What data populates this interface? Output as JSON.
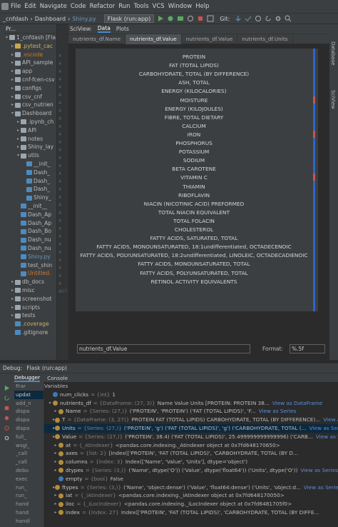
{
  "menu": {
    "items": [
      "File",
      "Edit",
      "Navigate",
      "Code",
      "Refactor",
      "Run",
      "Tools",
      "VCS",
      "Window",
      "Help"
    ]
  },
  "navbar": {
    "crumbs": [
      "_cnfdash",
      "Dashboard",
      "Shiny.py"
    ],
    "run_config": "Flask (run:app)",
    "git_label": "Git:"
  },
  "project": {
    "header": "Pr...",
    "items": [
      {
        "label": "1_cnfdash [Fla",
        "indent": 0,
        "arrow": "▾",
        "type": "folder"
      },
      {
        "label": ".pytest_cac",
        "indent": 1,
        "arrow": "▸",
        "type": "folder-yellow",
        "color": "yellow"
      },
      {
        "label": ".vscode",
        "indent": 1,
        "arrow": "▸",
        "type": "folder",
        "color": "orange"
      },
      {
        "label": "API_sample",
        "indent": 1,
        "arrow": "▸",
        "type": "folder"
      },
      {
        "label": "app",
        "indent": 1,
        "arrow": "▸",
        "type": "folder"
      },
      {
        "label": "cnf-fcen-csv",
        "indent": 1,
        "arrow": "▸",
        "type": "folder"
      },
      {
        "label": "configs",
        "indent": 1,
        "arrow": "▸",
        "type": "folder"
      },
      {
        "label": "csv_cnf",
        "indent": 1,
        "arrow": "▸",
        "type": "folder"
      },
      {
        "label": "csv_nutrien",
        "indent": 1,
        "arrow": "▸",
        "type": "folder"
      },
      {
        "label": "Dashboard",
        "indent": 1,
        "arrow": "▾",
        "type": "folder"
      },
      {
        "label": ".ipynb_ch",
        "indent": 2,
        "arrow": "▸",
        "type": "folder"
      },
      {
        "label": "API",
        "indent": 2,
        "arrow": "▸",
        "type": "folder"
      },
      {
        "label": "notes",
        "indent": 2,
        "arrow": "▸",
        "type": "folder"
      },
      {
        "label": "Shiny_lay",
        "indent": 2,
        "arrow": "▸",
        "type": "folder"
      },
      {
        "label": "utils",
        "indent": 2,
        "arrow": "▾",
        "type": "folder"
      },
      {
        "label": "__init_",
        "indent": 3,
        "arrow": "",
        "type": "py"
      },
      {
        "label": "Dash_",
        "indent": 3,
        "arrow": "",
        "type": "py"
      },
      {
        "label": "Dash_",
        "indent": 3,
        "arrow": "",
        "type": "py"
      },
      {
        "label": "Dash_",
        "indent": 3,
        "arrow": "",
        "type": "py"
      },
      {
        "label": "Shiny_",
        "indent": 3,
        "arrow": "",
        "type": "py"
      },
      {
        "label": "__init__",
        "indent": 2,
        "arrow": "",
        "type": "py"
      },
      {
        "label": "Dash_Ap",
        "indent": 2,
        "arrow": "",
        "type": "py"
      },
      {
        "label": "Dash_Ap",
        "indent": 2,
        "arrow": "",
        "type": "py"
      },
      {
        "label": "Dash_Bo",
        "indent": 2,
        "arrow": "",
        "type": "py"
      },
      {
        "label": "Dash_nu",
        "indent": 2,
        "arrow": "",
        "type": "py"
      },
      {
        "label": "Dash_nu",
        "indent": 2,
        "arrow": "",
        "type": "py"
      },
      {
        "label": "Shiny.py",
        "indent": 2,
        "arrow": "",
        "type": "py",
        "color": "blue"
      },
      {
        "label": "test_shin",
        "indent": 2,
        "arrow": "",
        "type": "py"
      },
      {
        "label": "Untitled.",
        "indent": 2,
        "arrow": "",
        "type": "py",
        "color": "orange"
      },
      {
        "label": "db_docs",
        "indent": 1,
        "arrow": "▸",
        "type": "folder"
      },
      {
        "label": "misc",
        "indent": 1,
        "arrow": "▸",
        "type": "folder"
      },
      {
        "label": "screenshot",
        "indent": 1,
        "arrow": "▸",
        "type": "folder"
      },
      {
        "label": "scripts",
        "indent": 1,
        "arrow": "▸",
        "type": "folder"
      },
      {
        "label": "tests",
        "indent": 1,
        "arrow": "▸",
        "type": "folder"
      },
      {
        "label": ".coverage",
        "indent": 1,
        "arrow": "",
        "type": "file",
        "color": "yellow"
      },
      {
        "label": ".gitignore",
        "indent": 1,
        "arrow": "",
        "type": "file"
      }
    ]
  },
  "gutter": {
    "numbers": [
      "4",
      "4",
      "4",
      "4",
      "4",
      "4",
      "4",
      "4",
      "4",
      "4",
      "4",
      "4",
      "4",
      "4",
      "4",
      "4",
      "4",
      "4",
      "4",
      "4",
      "4",
      "4",
      "4",
      "4",
      "4",
      "4",
      "4",
      "4",
      "4",
      "4",
      "457"
    ]
  },
  "sciview": {
    "header_tabs": [
      "SciView:",
      "Data",
      "Plots"
    ],
    "file_tabs": [
      "nutrients_df.Name",
      "nutrients_df.Value",
      "nutrients_df.Value",
      "nutrients_df.Units"
    ],
    "rows": [
      "PROTEIN",
      "FAT (TOTAL LIPIDS)",
      "CARBOHYDRATE, TOTAL (BY DIFFERENCE)",
      "ASH, TOTAL",
      "ENERGY (KILOCALORIES)",
      "MOISTURE",
      "ENERGY (KILOJOULES)",
      "FIBRE, TOTAL DIETARY",
      "CALCIUM",
      "IRON",
      "PHOSPHORUS",
      "POTASSIUM",
      "SODIUM",
      "BETA CAROTENE",
      "VITAMIN C",
      "THIAMIN",
      "RIBOFLAVIN",
      "NIACIN (NICOTINIC ACID) PREFORMED",
      "TOTAL NIACIN EQUIVALENT",
      "TOTAL FOLACIN",
      "CHOLESTEROL",
      "FATTY ACIDS, SATURATED, TOTAL",
      "FATTY ACIDS, MONOUNSATURATED, 18:1undifferentiated, OCTADECENOIC",
      "FATTY ACIDS, POLYUNSATURATED, 18:2undifferentiated, LINOLEIC, OCTADECADIENOIC",
      "FATTY ACIDS, MONOUNSATURATED, TOTAL",
      "FATTY ACIDS, POLYUNSATURATED, TOTAL",
      "RETINOL ACTIVITY EQUIVALENTS"
    ],
    "value_field": "nutrients_df.Value",
    "format_label": "Format:",
    "format_value": "%.5f"
  },
  "right_strip": {
    "labels": [
      "Database",
      "SciView"
    ]
  },
  "debug": {
    "title": "Debug:",
    "config_tab": "Flask (run:app)",
    "tabs": [
      "Debugger",
      "Console"
    ],
    "frames_label": "Frar",
    "variables_label": "Variables",
    "frames": [
      "updat",
      "add_n",
      "dispa",
      "dispa",
      "dispa",
      "full_",
      "wsgi_",
      "_call",
      "_call",
      "debu",
      "exec",
      "run_",
      "run_",
      "hand",
      "hand",
      "handl"
    ],
    "vars": [
      {
        "arrow": "",
        "icon": "blue",
        "name": "num_clicks",
        "type": "= {int}",
        "value": "1",
        "link": ""
      },
      {
        "arrow": "▾",
        "icon": "orange",
        "name": "nutrients_df",
        "type": "= {DataFrame: (27, 3)}",
        "value": "Name Value Units [PROTEIN: PROTEIN 38...",
        "link": "View as DataFrame"
      },
      {
        "arrow": "▸",
        "icon": "orange",
        "name": "Name",
        "type": "= {Series: (27,)}",
        "value": "('PROTEIN', 'PROTEIN') ('FAT (TOTAL LIPIDS)', 'F...",
        "link": "View as Series"
      },
      {
        "arrow": "▸",
        "icon": "orange",
        "name": "T",
        "type": "= {DataFrame: (3, 27)}",
        "value": "PROTEIN FAT (TOTAL LIPIDS) CARBOHYDRATE, TOTAL (BY DIFFERENCE)...",
        "link": "View as DataFrame"
      },
      {
        "arrow": "▸",
        "icon": "orange",
        "name": "Units",
        "type": "= {Series: (27,)}",
        "value": "('PROTEIN', 'g') ('FAT (TOTAL LIPIDS)', 'g') ('CARBOHYDRATE, TOTAL (...",
        "link": "View as Series"
      },
      {
        "arrow": "▸",
        "icon": "orange",
        "name": "Value",
        "type": "= {Series: (27,)}",
        "value": "('PROTEIN', 38.4) ('FAT (TOTAL LIPIDS)', 25.499999999999996) ('CARB...",
        "link": "View as Series"
      },
      {
        "arrow": "▸",
        "icon": "orange",
        "name": "at",
        "type": "= {_AtIndexer}",
        "value": "<pandas.core.indexing._AtIndexer object at 0x7fd648170650>",
        "link": ""
      },
      {
        "arrow": "▸",
        "icon": "orange",
        "name": "axes",
        "type": "= {list: 2}",
        "value": "[Index(['PROTEIN', 'FAT (TOTAL LIPIDS)', 'CARBOHYDRATE, TOTAL (BY D...",
        "link": ""
      },
      {
        "arrow": "▸",
        "icon": "orange",
        "name": "columns",
        "type": "= {Index: 3}",
        "value": "Index(['Name', 'Value', 'Units'], dtype='object')",
        "link": ""
      },
      {
        "arrow": "▸",
        "icon": "orange",
        "name": "dtypes",
        "type": "= {Series: (3,)}",
        "value": "('Name', dtype('O')) ('Value', dtype('float64')) ('Units', dtype('O'))",
        "link": "View as Series"
      },
      {
        "arrow": "",
        "icon": "blue",
        "name": "empty",
        "type": "= {bool}",
        "value": "False",
        "link": ""
      },
      {
        "arrow": "▸",
        "icon": "orange",
        "name": "ftypes",
        "type": "= {Series: (3,)}",
        "value": "('Name', 'object:dense') ('Value', 'float64:dense') ('Units', 'object:d...",
        "link": "View as Series"
      },
      {
        "arrow": "▸",
        "icon": "orange",
        "name": "iat",
        "type": "= {_iAtIndexer}",
        "value": "<pandas.core.indexing._iAtIndexer object at 0x7fd648170050>",
        "link": ""
      },
      {
        "arrow": "▸",
        "icon": "orange",
        "name": "iloc",
        "type": "= {_iLocIndexer}",
        "value": "<pandas.core.indexing._iLocIndexer object at 0x7fd6481705f0>",
        "link": ""
      },
      {
        "arrow": "▸",
        "icon": "orange",
        "name": "index",
        "type": "= {Index: 27}",
        "value": "Index(['PROTEIN', 'FAT (TOTAL LIPIDS)', 'CARBOHYDRATE, TOTAL (BY DIFFE...",
        "link": ""
      }
    ]
  },
  "colors": {
    "accent": "#4a88c7",
    "selection": "#0d293e",
    "link": "#5c8fd8",
    "scrollbar": "#2f65ca"
  }
}
